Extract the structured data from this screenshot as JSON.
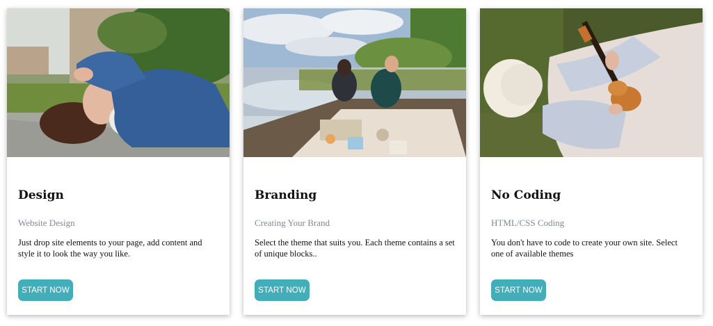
{
  "cards": [
    {
      "image": "woman-lying-on-pavement-photo",
      "title": "Design",
      "subtitle": "Website Design",
      "text": "Just drop site elements to your page, add content and style it to look the way you like.",
      "button": "START NOW"
    },
    {
      "image": "couple-picnic-on-lake-dock-photo",
      "title": "Branding",
      "subtitle": "Creating Your Brand",
      "text": "Select the theme that suits you. Each theme contains a set of unique blocks..",
      "button": "START NOW"
    },
    {
      "image": "woman-with-ukulele-on-grass-photo",
      "title": "No Coding",
      "subtitle": "HTML/CSS Coding",
      "text": "You don't have to code to create your own site. Select one of available themes",
      "button": "START NOW"
    }
  ],
  "colors": {
    "button": "#43adb9",
    "subtitle": "#7f8a96",
    "title": "#111111"
  }
}
